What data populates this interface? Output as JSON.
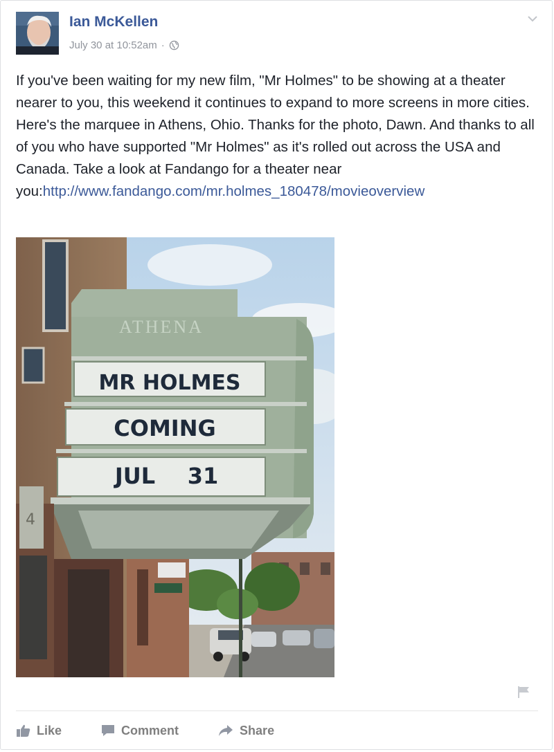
{
  "post": {
    "author": "Ian McKellen",
    "timestamp": "July 30 at 10:52am",
    "separator": "·",
    "privacy_icon": "globe-icon",
    "text": "If you've been waiting for my new film, \"Mr Holmes\" to be showing at a theater nearer to you, this weekend it continues to expand to more screens in more cities. Here's the marquee in Athens, Ohio. Thanks for the photo, Dawn. And thanks to all of you who have supported \"Mr Holmes\" as it's rolled out across the USA and Canada. Take a look at Fandango for a theater near you:",
    "link": "http://www.fandango.com/mr.holmes_180478/movieoverview",
    "photo": {
      "marquee_name": "ATHENA",
      "line1": "MR HOLMES",
      "line2": "COMING",
      "line3_month": "JUL",
      "line3_day": "31",
      "building_number": "4"
    }
  },
  "actions": {
    "like": "Like",
    "comment": "Comment",
    "share": "Share"
  },
  "colors": {
    "link": "#3b5998",
    "text": "#1d2129",
    "meta": "#90949c",
    "action": "#7f7f7f"
  }
}
